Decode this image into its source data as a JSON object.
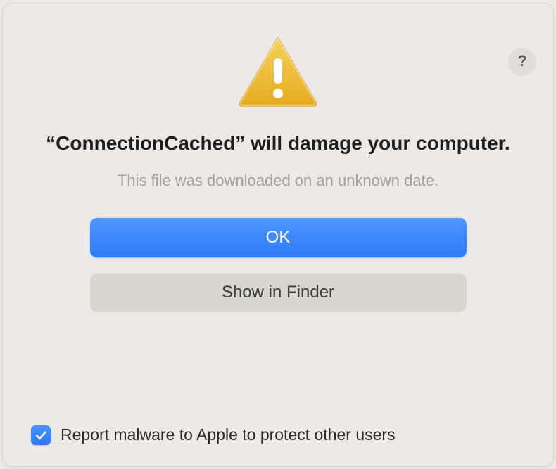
{
  "help": "?",
  "title": "“ConnectionCached” will damage your computer.",
  "subtitle": "This file was downloaded on an unknown date.",
  "buttons": {
    "primary": "OK",
    "secondary": "Show in Finder"
  },
  "checkbox": {
    "checked": true,
    "label": "Report malware to Apple to protect other users"
  }
}
